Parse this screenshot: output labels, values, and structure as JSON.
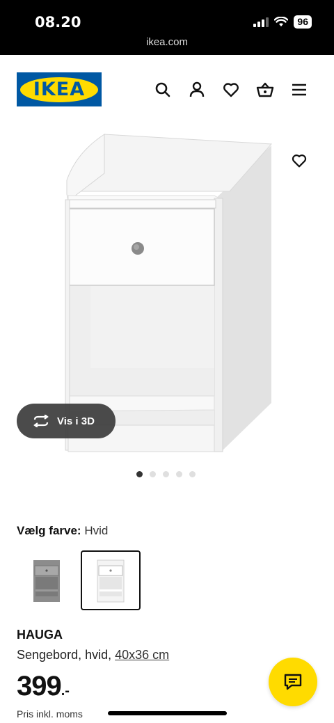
{
  "status_bar": {
    "time": "08.20",
    "battery": "96",
    "url": "ikea.com"
  },
  "header": {
    "logo_text": "IKEA",
    "brand_blue": "#0058a3",
    "brand_yellow": "#ffdb00",
    "icons": [
      "search-icon",
      "account-icon",
      "heart-icon",
      "basket-icon",
      "menu-icon"
    ]
  },
  "gallery": {
    "view_3d_label": "Vis i 3D",
    "image_count": 5,
    "active_index": 0
  },
  "color_picker": {
    "label": "Vælg farve:",
    "selected": "Hvid",
    "options": [
      "Grå",
      "Hvid"
    ]
  },
  "product": {
    "name": "HAUGA",
    "description": "Sengebord, hvid,",
    "dimensions": "40x36 cm",
    "price": "399",
    "price_suffix": ".-",
    "price_note": "Pris inkl. moms"
  }
}
